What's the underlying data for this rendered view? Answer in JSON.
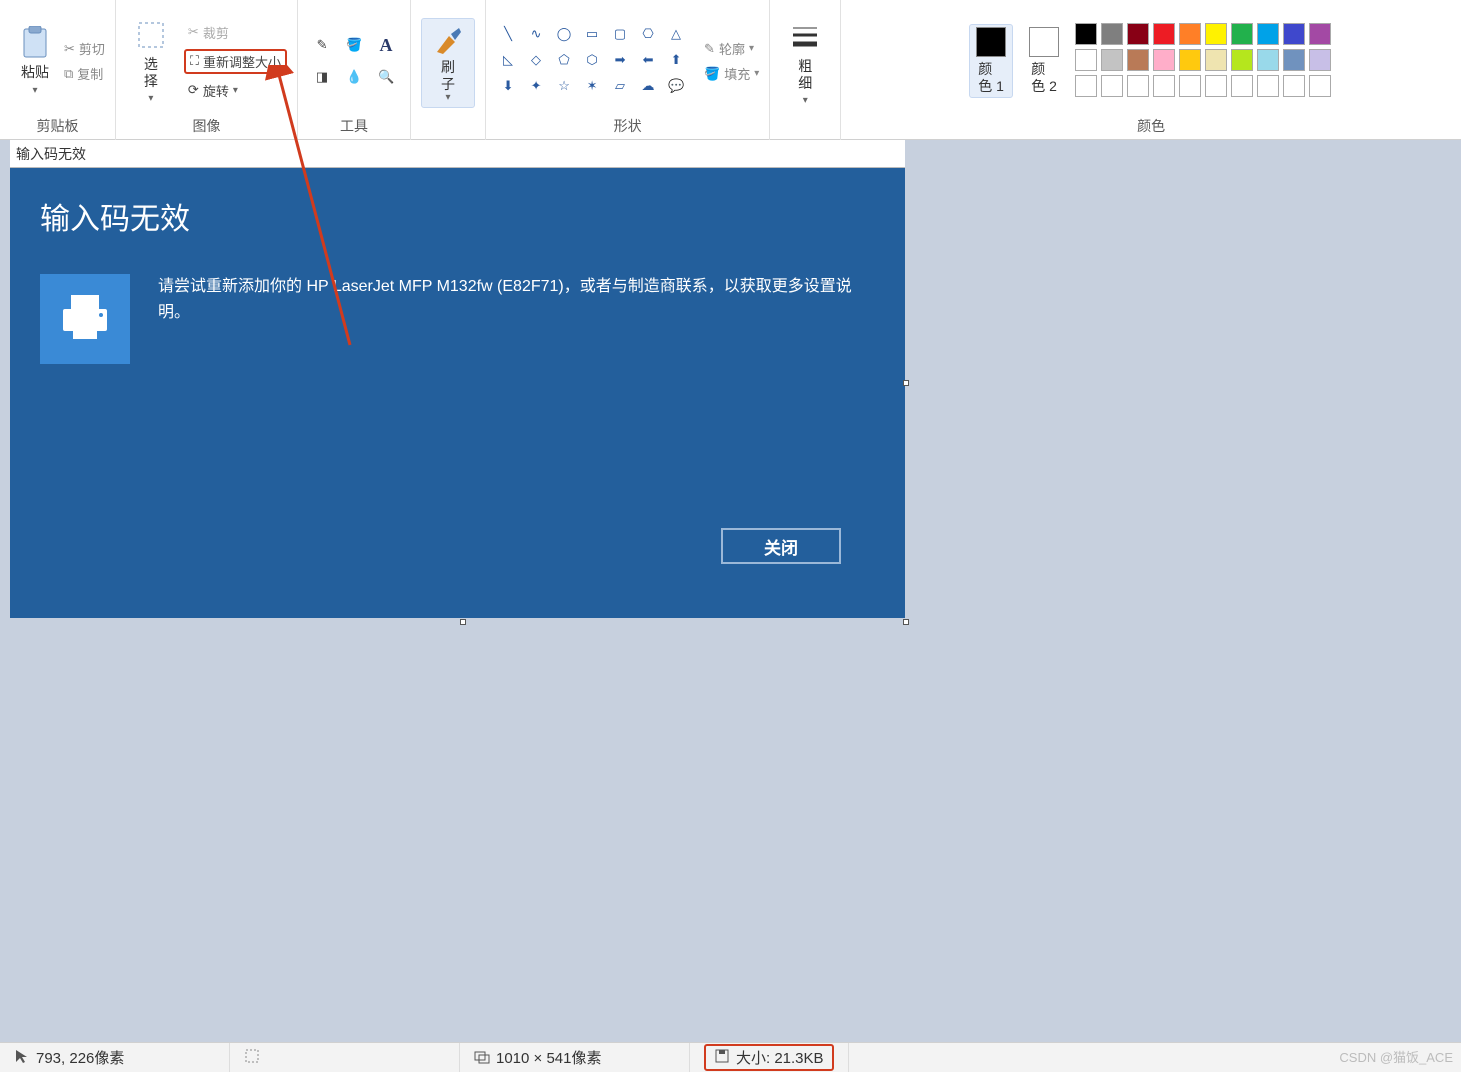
{
  "ribbon": {
    "clipboard": {
      "title": "剪贴板",
      "paste": "粘贴",
      "cut": "剪切",
      "copy": "复制"
    },
    "image": {
      "title": "图像",
      "select": "选\n择",
      "crop": "裁剪",
      "resize": "重新调整大小",
      "rotate": "旋转"
    },
    "tools": {
      "title": "工具"
    },
    "brush": {
      "title": "",
      "label": "刷\n子"
    },
    "shapes": {
      "title": "形状",
      "outline": "轮廓",
      "fill": "填充"
    },
    "size": {
      "title": "",
      "label": "粗\n细"
    },
    "colors": {
      "title": "颜色",
      "color1": "颜\n色 1",
      "color2": "颜\n色 2",
      "palette": [
        "#000000",
        "#7f7f7f",
        "#880015",
        "#ed1c24",
        "#ff7f27",
        "#fff200",
        "#22b14c",
        "#00a2e8",
        "#3f48cc",
        "#a349a4",
        "#ffffff",
        "#c3c3c3",
        "#b97a57",
        "#ffaec9",
        "#ffc90e",
        "#efe4b0",
        "#b5e61d",
        "#99d9ea",
        "#7092be",
        "#c8bfe7",
        "#ffffff",
        "#ffffff",
        "#ffffff",
        "#ffffff",
        "#ffffff",
        "#ffffff",
        "#ffffff",
        "#ffffff",
        "#ffffff",
        "#ffffff"
      ]
    }
  },
  "document": {
    "titlebar": "输入码无效",
    "heading": "输入码无效",
    "message": "请尝试重新添加你的 HP LaserJet MFP M132fw (E82F71)，或者与制造商联系，以获取更多设置说明。",
    "close": "关闭"
  },
  "statusbar": {
    "position": "793, 226像素",
    "dimensions": "1010 × 541像素",
    "size": "大小: 21.3KB"
  },
  "watermark": "CSDN @猫饭_ACE"
}
